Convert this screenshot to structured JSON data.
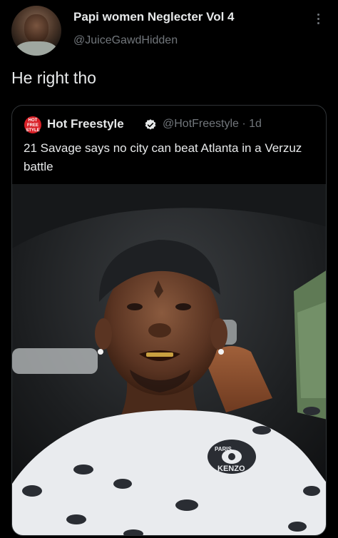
{
  "author": {
    "display_name": "Papi women Neglecter Vol 4",
    "handle": "@JuiceGawdHidden"
  },
  "tweet": {
    "text": "He right tho"
  },
  "quoted": {
    "logo_text": "HOT FREE STYLE",
    "display_name": "Hot Freestyle",
    "meta": "@HotFreestyle · 1d",
    "text": "21 Savage says no city can beat Atlanta in a Verzuz battle",
    "shirt_text": "KENZO",
    "shirt_small_text": "PARIS"
  },
  "icons": {
    "more": "more-vertical-icon",
    "verified": "verified-badge-icon"
  },
  "colors": {
    "background": "#000000",
    "text": "#e7e9ea",
    "secondary": "#71767b",
    "border": "#2f3336",
    "brand_red": "#d92027"
  }
}
